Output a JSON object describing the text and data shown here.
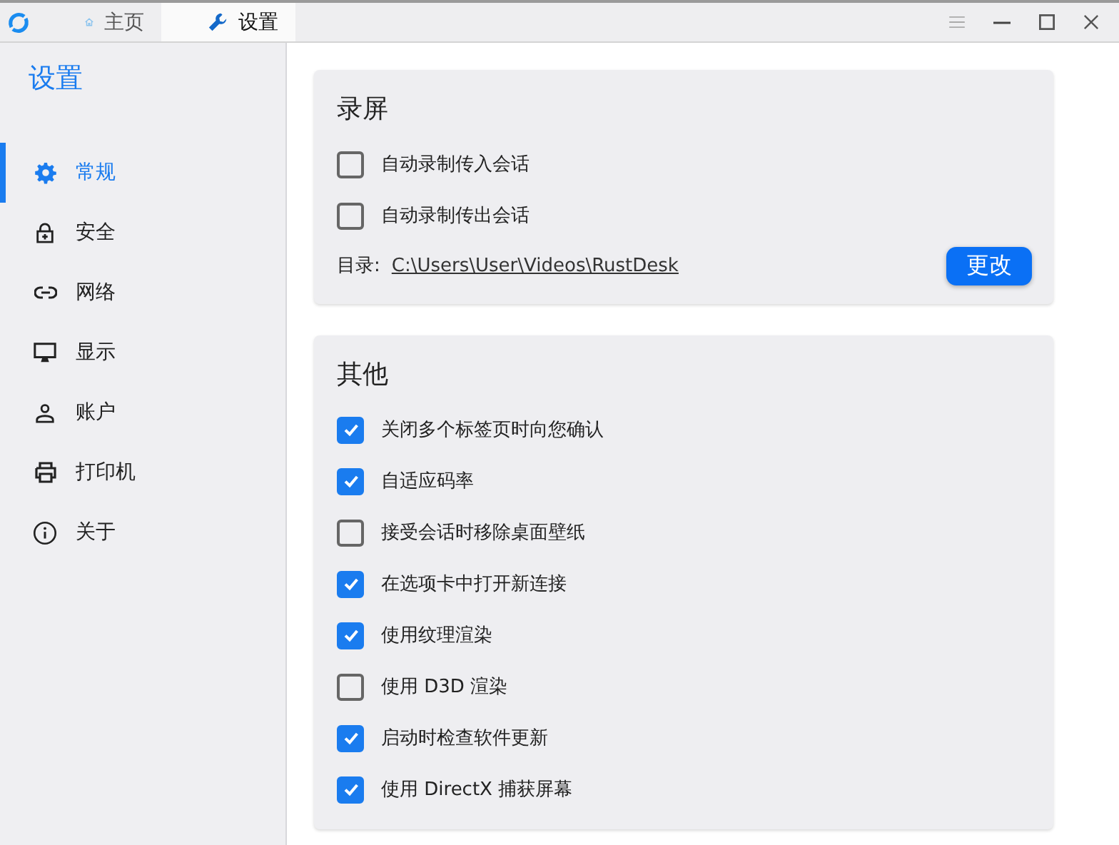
{
  "tabs": [
    {
      "label": "主页",
      "selected": false
    },
    {
      "label": "设置",
      "selected": true
    }
  ],
  "sidebar": {
    "title": "设置",
    "items": [
      {
        "label": "常规",
        "selected": true
      },
      {
        "label": "安全",
        "selected": false
      },
      {
        "label": "网络",
        "selected": false
      },
      {
        "label": "显示",
        "selected": false
      },
      {
        "label": "账户",
        "selected": false
      },
      {
        "label": "打印机",
        "selected": false
      },
      {
        "label": "关于",
        "selected": false
      }
    ]
  },
  "sections": [
    {
      "title": "录屏",
      "options": [
        {
          "label": "自动录制传入会话",
          "checked": false
        },
        {
          "label": "自动录制传出会话",
          "checked": false
        }
      ],
      "directory": {
        "label": "目录:",
        "path": "C:\\Users\\User\\Videos\\RustDesk",
        "button": "更改"
      }
    },
    {
      "title": "其他",
      "options": [
        {
          "label": "关闭多个标签页时向您确认",
          "checked": true
        },
        {
          "label": "自适应码率",
          "checked": true
        },
        {
          "label": "接受会话时移除桌面壁纸",
          "checked": false
        },
        {
          "label": "在选项卡中打开新连接",
          "checked": true
        },
        {
          "label": "使用纹理渲染",
          "checked": true
        },
        {
          "label": "使用 D3D 渲染",
          "checked": false
        },
        {
          "label": "启动时检查软件更新",
          "checked": true
        },
        {
          "label": "使用 DirectX 捕获屏幕",
          "checked": true
        }
      ]
    }
  ]
}
